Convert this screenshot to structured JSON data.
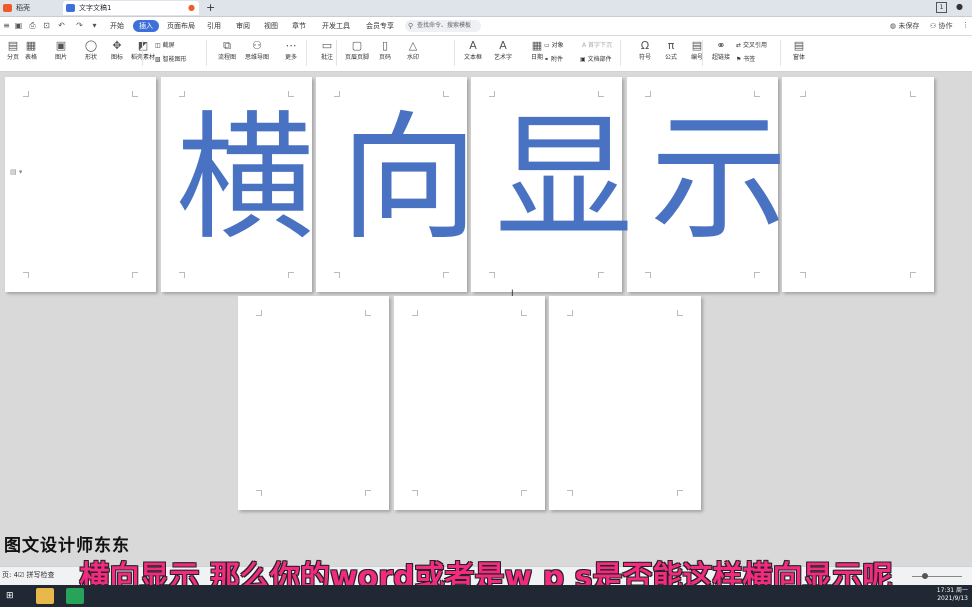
{
  "tabs": [
    {
      "label": "稻壳",
      "active": false
    },
    {
      "label": "文字文稿1",
      "active": true
    }
  ],
  "menu": {
    "items": [
      "开始",
      "插入",
      "页面布局",
      "引用",
      "审阅",
      "视图",
      "章节",
      "开发工具",
      "会员专享"
    ],
    "active": "插入",
    "search_placeholder": "查找命令、搜索模板",
    "unsaved": "未保存",
    "collaborate": "协作"
  },
  "toolbar": {
    "page_label": "分页",
    "items": [
      {
        "label": "分页",
        "glyph": "▤"
      },
      {
        "label": "表格",
        "glyph": "▦"
      },
      {
        "label": "图片",
        "glyph": "▣"
      },
      {
        "label": "形状",
        "glyph": "◯"
      },
      {
        "label": "图标",
        "glyph": "✥"
      },
      {
        "label": "稻壳素材",
        "glyph": "◩"
      },
      {
        "label": "流程图",
        "glyph": "⧉"
      },
      {
        "label": "思维导图",
        "glyph": "⚇"
      },
      {
        "label": "更多",
        "glyph": "⋯"
      },
      {
        "label": "批注",
        "glyph": "▭"
      },
      {
        "label": "页眉页脚",
        "glyph": "▢"
      },
      {
        "label": "页码",
        "glyph": "▯"
      },
      {
        "label": "水印",
        "glyph": "△"
      },
      {
        "label": "文本框",
        "glyph": "A"
      },
      {
        "label": "艺术字",
        "glyph": "A"
      },
      {
        "label": "日期",
        "glyph": "▦"
      },
      {
        "label": "符号",
        "glyph": "Ω"
      },
      {
        "label": "公式",
        "glyph": "π"
      },
      {
        "label": "编号",
        "glyph": "▤"
      },
      {
        "label": "超链接",
        "glyph": "⚭"
      },
      {
        "label": "窗体",
        "glyph": "▤"
      }
    ],
    "small": {
      "screenshot": "截屏",
      "smart_shape": "智能图形",
      "object": "对象",
      "dropcap": "首字下沉",
      "attachment": "附件",
      "doc_parts": "文档部件",
      "crossref": "交叉引用",
      "bookmark": "书签"
    }
  },
  "document": {
    "big_text": [
      "横",
      "向",
      "显",
      "示"
    ]
  },
  "status": {
    "page": "页: 4",
    "spell_check": "拼写检查"
  },
  "overlay": {
    "watermark": "图文设计师东东",
    "subtitle": "横向显示 那么你的word或者是w p s是否能这样横向显示呢"
  },
  "clock": {
    "time": "17:31 周一",
    "date": "2021/9/13"
  },
  "colors": {
    "accent": "#3f6fd8",
    "big_text": "#4a72c2",
    "subtitle": "#f22b80"
  }
}
